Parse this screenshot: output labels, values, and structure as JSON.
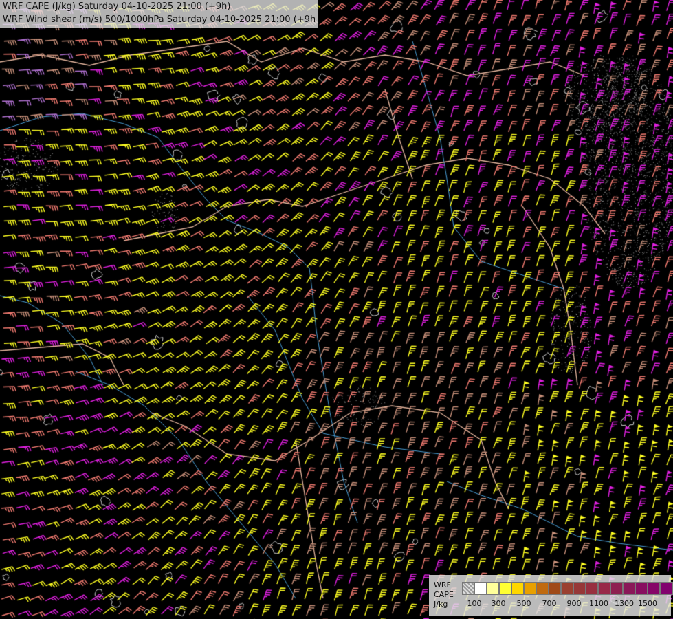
{
  "header": {
    "title_line1": "WRF CAPE (J/kg) Saturday 04-10-2025 21:00 (+9h)",
    "title_line2": "WRF Wind shear (m/s) 500/1000hPa Saturday 04-10-2025 21:00 (+9h)"
  },
  "legend": {
    "label_model": "WRF",
    "label_field": "CAPE",
    "label_unit": "J/kg",
    "swatch_colors": [
      "#b8b8b8",
      "#ffffff",
      "#ffff9a",
      "#ffff33",
      "#ffd700",
      "#e8a000",
      "#c06a10",
      "#a04a18",
      "#9a4030",
      "#963838",
      "#983040",
      "#982848",
      "#8e2050",
      "#8a1858",
      "#880e60",
      "#860668",
      "#82006e",
      "#7a0070"
    ],
    "ticks": [
      "100",
      "300",
      "500",
      "700",
      "900",
      "1100",
      "1300",
      "1500"
    ]
  },
  "map": {
    "wind_barb_colors": {
      "strong_shear": "#ffff22",
      "moderate_shear": "#f07a70",
      "light_shear": "#c8907a",
      "weak_shear": "#e020e0",
      "very_weak_shear": "#b070d0"
    },
    "border_color": "#e8b8a0",
    "river_color": "#4aa0d8",
    "contour_color": "#cfcfcf"
  }
}
